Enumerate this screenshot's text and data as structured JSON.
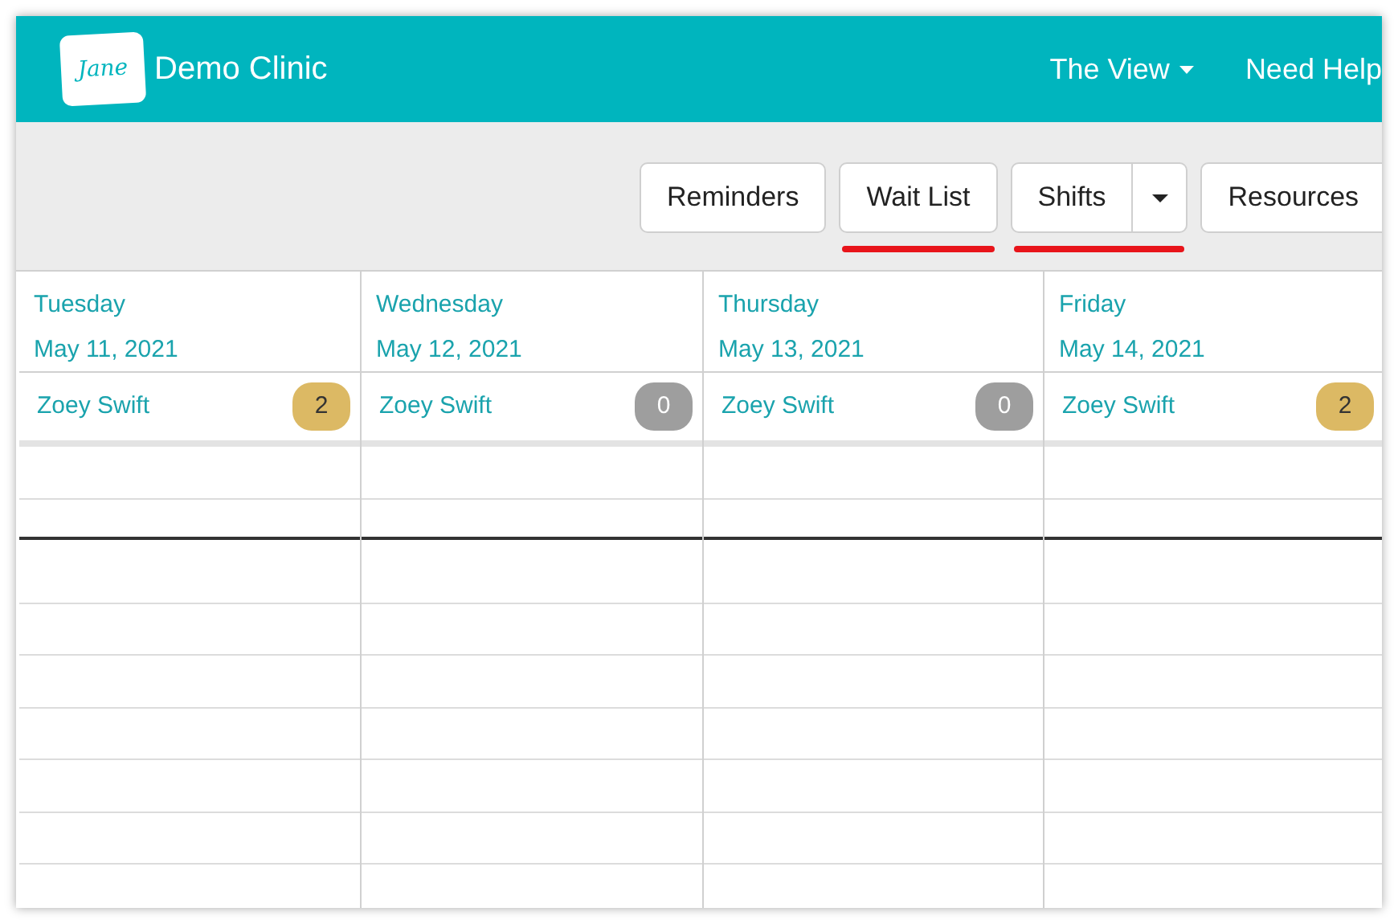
{
  "header": {
    "logo_text": "Jane",
    "clinic_name": "Demo Clinic",
    "nav": [
      {
        "label": "The View",
        "dropdown": true
      },
      {
        "label": "Need Help",
        "dropdown": false
      }
    ]
  },
  "toolbar": {
    "buttons": [
      {
        "label": "Reminders",
        "kind": "button",
        "highlighted": false
      },
      {
        "label": "Wait List",
        "kind": "button",
        "highlighted": true
      },
      {
        "label": "Shifts",
        "kind": "split",
        "highlighted": true
      },
      {
        "label": "Resources",
        "kind": "button",
        "highlighted": false
      }
    ]
  },
  "calendar": {
    "days": [
      {
        "weekday": "Tuesday",
        "date": "May 11, 2021",
        "staff": "Zoey Swift",
        "count": "2",
        "color": "#dcb964"
      },
      {
        "weekday": "Wednesday",
        "date": "May 12, 2021",
        "staff": "Zoey Swift",
        "count": "0",
        "color": "#9e9e9e"
      },
      {
        "weekday": "Thursday",
        "date": "May 13, 2021",
        "staff": "Zoey Swift",
        "count": "0",
        "color": "#9e9e9e"
      },
      {
        "weekday": "Friday",
        "date": "May 14, 2021",
        "staff": "Zoey Swift",
        "count": "2",
        "color": "#dcb964"
      }
    ]
  }
}
